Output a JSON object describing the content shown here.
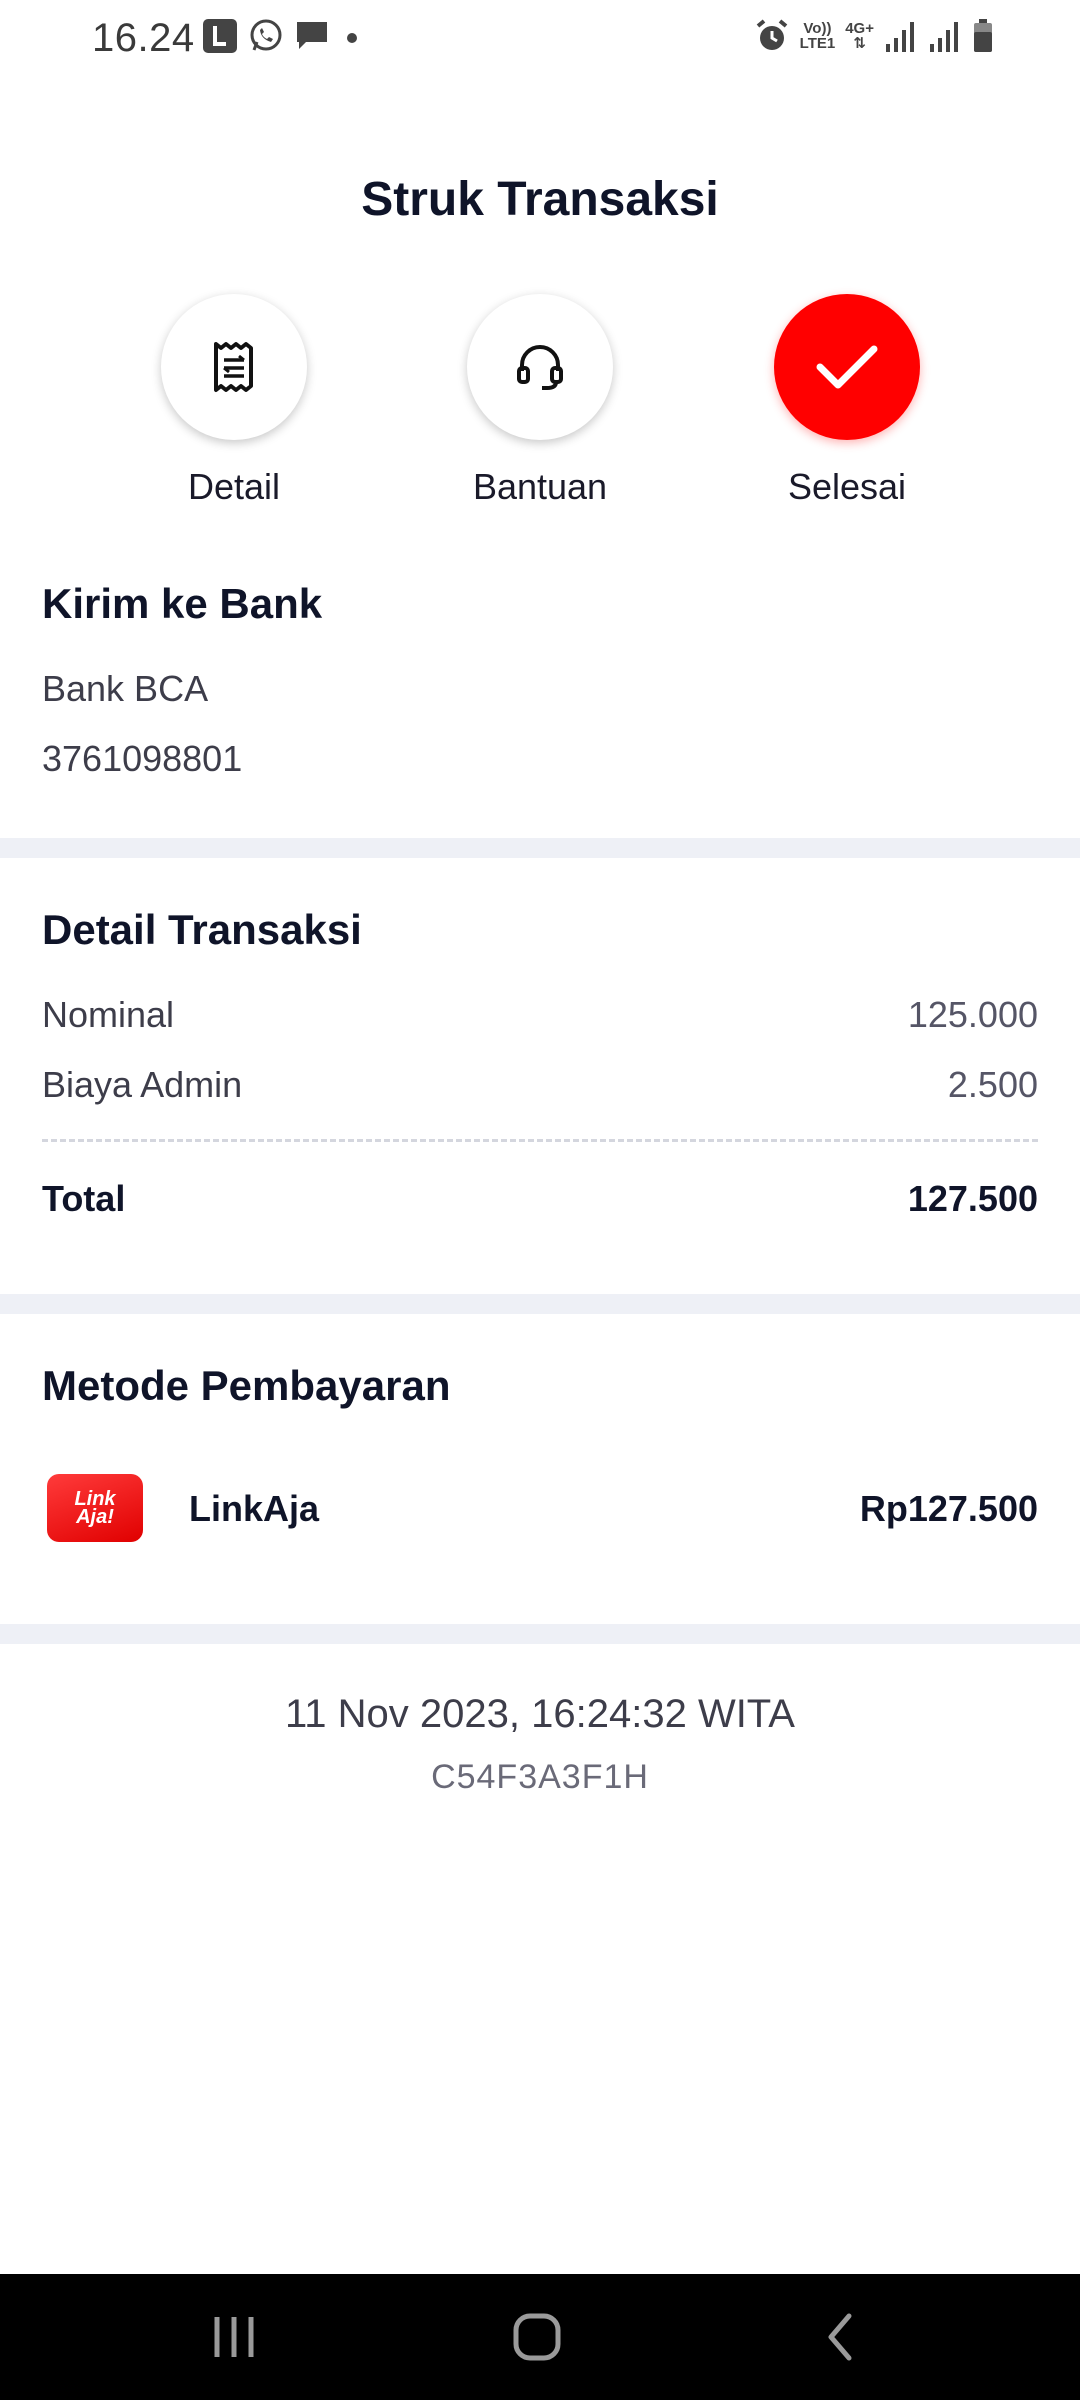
{
  "status_bar": {
    "time": "16.24",
    "volte": "Vo))",
    "lte": "LTE1",
    "net": "4G+"
  },
  "page": {
    "title": "Struk Transaksi"
  },
  "actions": [
    {
      "label": "Detail",
      "icon": "receipt-icon"
    },
    {
      "label": "Bantuan",
      "icon": "headset-icon"
    },
    {
      "label": "Selesai",
      "icon": "check-icon"
    }
  ],
  "recipient": {
    "title": "Kirim ke Bank",
    "bank": "Bank BCA",
    "account": "3761098801"
  },
  "transaction": {
    "title": "Detail Transaksi",
    "nominal_label": "Nominal",
    "nominal_value": "125.000",
    "admin_label": "Biaya Admin",
    "admin_value": "2.500",
    "total_label": "Total",
    "total_value": "127.500"
  },
  "payment": {
    "title": "Metode Pembayaran",
    "logo_line1": "Link",
    "logo_line2": "Aja!",
    "method": "LinkAja",
    "amount": "Rp127.500"
  },
  "footer": {
    "datetime": "11 Nov 2023, 16:24:32 WITA",
    "code": "C54F3A3F1H"
  },
  "colors": {
    "accent": "#ff0000",
    "divider": "#eef0f6",
    "text_dark": "#0f1429"
  }
}
